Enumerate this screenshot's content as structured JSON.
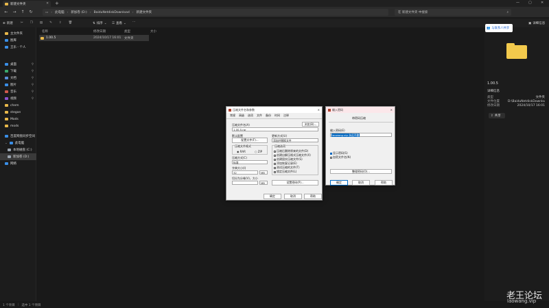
{
  "tab": {
    "title": "新建文件夹",
    "add_label": "+"
  },
  "nav": {
    "breadcrumbs": [
      "此电脑",
      "新加卷 (D:)",
      "BaiduNetdiskDownload",
      "新建文件夹"
    ],
    "search_placeholder": "在 新建文件夹 中搜索"
  },
  "cmd": {
    "new_label": "新建",
    "sort_label": "排序",
    "view_label": "查看",
    "details_label": "详细信息"
  },
  "sidebar": {
    "items": [
      {
        "label": "主文件夹",
        "color": "#e8b84a"
      },
      {
        "label": "图库",
        "color": "#3a8ee6"
      },
      {
        "label": "王乐 - 个人",
        "color": "#3a8ee6"
      },
      {
        "label": "桌面",
        "color": "#3a8ee6"
      },
      {
        "label": "下载",
        "color": "#3aa86b"
      },
      {
        "label": "文档",
        "color": "#5a8fd8"
      },
      {
        "label": "图片",
        "color": "#3a8ee6"
      },
      {
        "label": "音乐",
        "color": "#d0584b"
      },
      {
        "label": "视频",
        "color": "#8b53d0"
      },
      {
        "label": "chem",
        "color": "#e8b84a"
      },
      {
        "label": "stegan",
        "color": "#e8b84a"
      },
      {
        "label": "Mods",
        "color": "#e8b84a"
      },
      {
        "label": "mods",
        "color": "#e8b84a"
      },
      {
        "label": "百度网盘同步空间",
        "color": "#3a8ee6"
      },
      {
        "label": "此电脑",
        "color": "#3a8ee6"
      },
      {
        "label": "本地磁盘 (C:)",
        "color": "#9aa4b0"
      },
      {
        "label": "新加卷 (D:)",
        "color": "#9aa4b0"
      },
      {
        "label": "网络",
        "color": "#3a8ee6"
      }
    ]
  },
  "list": {
    "headers": [
      "名称",
      "修改日期",
      "类型",
      "大小"
    ],
    "rows": [
      {
        "name": "1.00.5",
        "date": "2024/10/17 16:01",
        "type": "文件夹",
        "size": ""
      }
    ]
  },
  "details": {
    "share_label": "与联系人共享",
    "folder_name": "1.00.5",
    "section_title": "详细信息",
    "rows": [
      {
        "label": "类型",
        "value": "文件夹"
      },
      {
        "label": "文件位置",
        "value": "D:\\BaiduNetdiskDownload\\新建..."
      },
      {
        "label": "修改日期",
        "value": "2024/10/17 16:01"
      }
    ],
    "share_button": "共享"
  },
  "status": {
    "items": "1 个项目",
    "selected": "选中 1 个项目"
  },
  "dialog_archive": {
    "title": "压缩文件名和参数",
    "tabs": [
      "常规",
      "高级",
      "选项",
      "文件",
      "备份",
      "时间",
      "注释"
    ],
    "name_label": "压缩文件名(A)",
    "browse_btn": "浏览(B)...",
    "name_value": "1.00.5.rar",
    "profile_label": "默认配置",
    "profile_btn": "配置文件(F)...",
    "update_label": "更新方式(U)",
    "update_value": "添加并替换文件",
    "format_label": "压缩文件格式",
    "format_options": [
      "RAR",
      "ZIP"
    ],
    "options_label": "压缩选项",
    "options": [
      "压缩后删除原来的文件(D)",
      "创建自解压格式压缩文件(X)",
      "创建固实压缩文件(S)",
      "添加恢复记录(E)",
      "测试压缩的文件(T)",
      "锁定压缩文件(L)"
    ],
    "method_label": "压缩方式(C)",
    "method_value": "标准",
    "dict_label": "字典大小(I)",
    "dict_value": "32",
    "dict_unit": "MB",
    "split_label": "切分为分卷(V)，大小",
    "split_unit": "MB",
    "password_btn": "设置密码(P)...",
    "ok": "确定",
    "cancel": "取消",
    "help": "帮助"
  },
  "dialog_password": {
    "title": "输入密码",
    "heading": "带密码压缩",
    "field_label": "输入密码(E)",
    "field_value": "laowang.vip 永远不删",
    "show_label": "显示密码(S)",
    "encrypt_label": "加密文件名(N)",
    "manage_btn": "整理密码(O)...",
    "ok": "确定",
    "cancel": "取消",
    "help": "帮助"
  },
  "watermark": {
    "title": "老王论坛",
    "url": "laowang.vip"
  }
}
